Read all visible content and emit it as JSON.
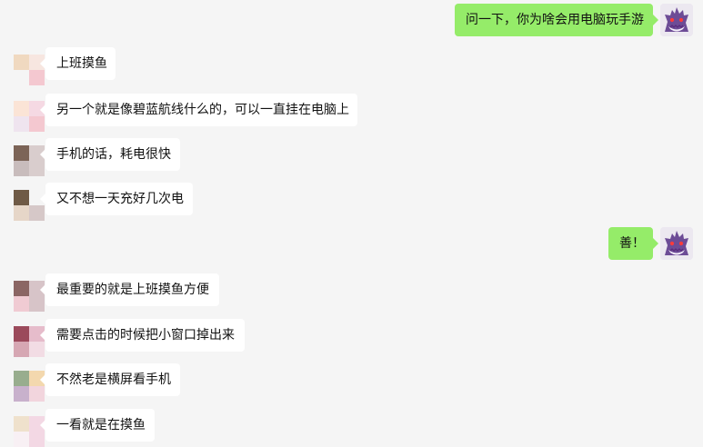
{
  "chat": {
    "messages": [
      {
        "side": "right",
        "text": "问一下，你为啥会用电脑玩手游"
      },
      {
        "side": "left",
        "text": "上班摸鱼"
      },
      {
        "side": "left",
        "text": "另一个就是像碧蓝航线什么的，可以一直挂在电脑上"
      },
      {
        "side": "left",
        "text": "手机的话，耗电很快"
      },
      {
        "side": "left",
        "text": "又不想一天充好几次电"
      },
      {
        "side": "right",
        "text": "善！"
      },
      {
        "side": "left",
        "text": "最重要的就是上班摸鱼方便"
      },
      {
        "side": "left",
        "text": "需要点击的时候把小窗口掉出来"
      },
      {
        "side": "left",
        "text": "不然老是横屏看手机"
      },
      {
        "side": "left",
        "text": "一看就是在摸鱼"
      }
    ]
  },
  "colors": {
    "background": "#f5f5f5",
    "left_bubble": "#ffffff",
    "right_bubble": "#95ec69",
    "text": "#111111"
  },
  "icons": {
    "left_avatar": "blurred-pixel-avatar",
    "right_avatar": "purple-ghost-avatar"
  }
}
